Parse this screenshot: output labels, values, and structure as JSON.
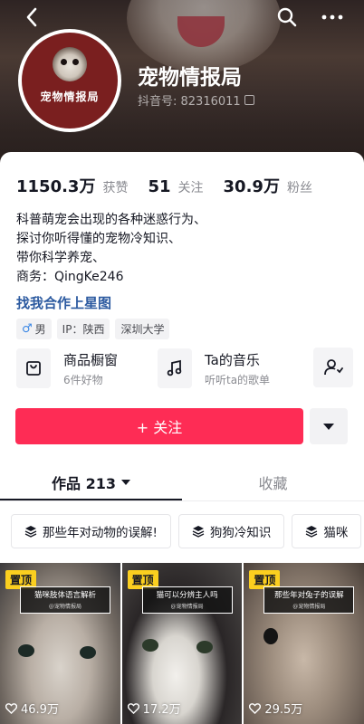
{
  "profile": {
    "name": "宠物情报局",
    "douyin_id": "抖音号: 82316011",
    "avatar_text": "宠物情报局"
  },
  "stats": [
    {
      "value": "1150.3万",
      "label": "获赞"
    },
    {
      "value": "51",
      "label": "关注"
    },
    {
      "value": "30.9万",
      "label": "粉丝"
    }
  ],
  "bio": {
    "lines": [
      "科普萌宠会出现的各种迷惑行为、",
      "探讨你听得懂的宠物冷知识、",
      "带你科学养宠、",
      "商务：QingKe246"
    ],
    "link": "找我合作上星图"
  },
  "tags": {
    "gender": "男",
    "ip": "IP：陕西",
    "school": "深圳大学"
  },
  "entries": [
    {
      "title": "商品橱窗",
      "sub": "6件好物",
      "icon": "shop-icon"
    },
    {
      "title": "Ta的音乐",
      "sub": "听听ta的歌单",
      "icon": "music-icon"
    }
  ],
  "actions": {
    "follow_label": "+ 关注"
  },
  "tabs": [
    {
      "label": "作品 213",
      "active": true
    },
    {
      "label": "收藏",
      "active": false
    }
  ],
  "collections": [
    "那些年对动物的误解!",
    "狗狗冷知识",
    "猫咪"
  ],
  "videos": [
    {
      "pinned": "置顶",
      "title": "猫咪肢体语言解析",
      "subtitle": "@宠物情报局",
      "likes": "46.9万"
    },
    {
      "pinned": "置顶",
      "title": "猫可以分辨主人吗",
      "subtitle": "@宠物情报局",
      "likes": "17.2万"
    },
    {
      "pinned": "置顶",
      "title": "那些年对兔子的误解",
      "subtitle": "@宠物情报局",
      "likes": "29.5万"
    }
  ],
  "colors": {
    "accent": "#fe2c55",
    "link": "#2c5aa0",
    "pin": "#fbcf1f"
  }
}
